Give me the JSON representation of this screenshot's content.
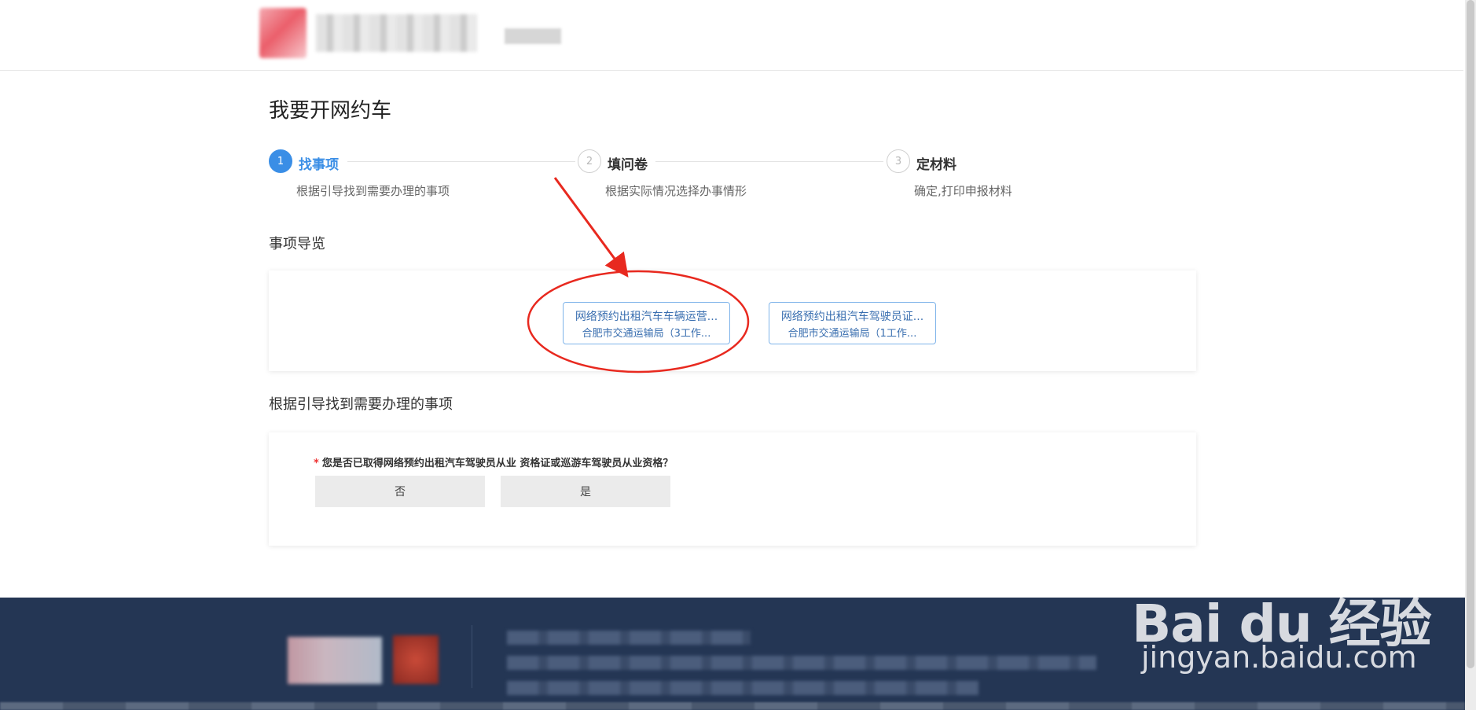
{
  "page": {
    "title": "我要开网约车"
  },
  "steps": [
    {
      "number": "1",
      "title": "找事项",
      "desc": "根据引导找到需要办理的事项",
      "active": true
    },
    {
      "number": "2",
      "title": "填问卷",
      "desc": "根据实际情况选择办事情形",
      "active": false
    },
    {
      "number": "3",
      "title": "定材料",
      "desc": "确定,打印申报材料",
      "active": false
    }
  ],
  "navigation": {
    "label": "事项导览",
    "items": [
      {
        "line1": "网络预约出租汽车车辆运营...",
        "line2": "合肥市交通运输局（3工作..."
      },
      {
        "line1": "网络预约出租汽车驾驶员证...",
        "line2": "合肥市交通运输局（1工作..."
      }
    ]
  },
  "guide": {
    "label": "根据引导找到需要办理的事项",
    "question": {
      "required_mark": "*",
      "text": "您是否已取得网络预约出租汽车驾驶员从业 资格证或巡游车驾驶员从业资格？",
      "options": [
        "否",
        "是"
      ]
    }
  },
  "watermark": {
    "brand": "Bai du 经验",
    "url": "jingyan.baidu.com"
  },
  "colors": {
    "accent": "#3a8ee6",
    "footer": "#243654",
    "annotation": "#e8291f"
  }
}
